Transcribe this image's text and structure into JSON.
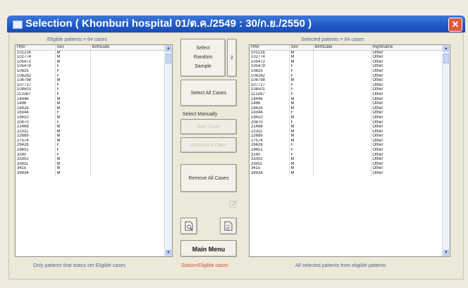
{
  "window": {
    "title": "Selection  ( Khonburi hospital  01/ต.ค./2549 : 30/ก.ย./2550 )",
    "close_glyph": "✕"
  },
  "left": {
    "caption": "Eligible patients = 64  cases",
    "columns": [
      "HN#",
      "Sex",
      "BirthDate"
    ],
    "rows": [
      [
        "101216",
        "M",
        ""
      ],
      [
        "102774",
        "M",
        ""
      ],
      [
        "105472",
        "M",
        ""
      ],
      [
        "105479",
        "F",
        ""
      ],
      [
        "10625",
        "F",
        ""
      ],
      [
        "106282",
        "F",
        ""
      ],
      [
        "106798",
        "M",
        ""
      ],
      [
        "107717",
        "F",
        ""
      ],
      [
        "108501",
        "F",
        ""
      ],
      [
        "113287",
        "F",
        ""
      ],
      [
        "14446",
        "M",
        ""
      ],
      [
        "1486",
        "M",
        ""
      ],
      [
        "18428",
        "M",
        ""
      ],
      [
        "18344",
        "F",
        ""
      ],
      [
        "19410",
        "M",
        ""
      ],
      [
        "20870",
        "F",
        ""
      ],
      [
        "21468",
        "M",
        ""
      ],
      [
        "22311",
        "M",
        ""
      ],
      [
        "22689",
        "M",
        ""
      ],
      [
        "27574",
        "M",
        ""
      ],
      [
        "29426",
        "F",
        ""
      ],
      [
        "29651",
        "F",
        ""
      ],
      [
        "3240",
        "F",
        ""
      ],
      [
        "33302",
        "M",
        ""
      ],
      [
        "33911",
        "M",
        ""
      ],
      [
        "3415",
        "M",
        ""
      ],
      [
        "39934",
        "M",
        ""
      ]
    ]
  },
  "right": {
    "caption": "Selected patients = 64  cases",
    "columns": [
      "HN#",
      "Sex",
      "BirthDate",
      "Rightname"
    ],
    "rows": [
      [
        "101216",
        "M",
        "",
        "Other"
      ],
      [
        "102774",
        "M",
        "",
        "Other"
      ],
      [
        "105472",
        "M",
        "",
        "Other"
      ],
      [
        "105479",
        "F",
        "",
        "Other"
      ],
      [
        "10625",
        "F",
        "",
        "Other"
      ],
      [
        "106282",
        "F",
        "",
        "Other"
      ],
      [
        "106798",
        "M",
        "",
        "Other"
      ],
      [
        "107717",
        "F",
        "",
        "Other"
      ],
      [
        "108501",
        "F",
        "",
        "Other"
      ],
      [
        "113287",
        "F",
        "",
        "Other"
      ],
      [
        "14446",
        "M",
        "",
        "Other"
      ],
      [
        "1486",
        "M",
        "",
        "Other"
      ],
      [
        "18428",
        "M",
        "",
        "Other"
      ],
      [
        "18344",
        "F",
        "",
        "Other"
      ],
      [
        "19410",
        "M",
        "",
        "Other"
      ],
      [
        "20870",
        "F",
        "",
        "Other"
      ],
      [
        "21468",
        "M",
        "",
        "Other"
      ],
      [
        "22311",
        "M",
        "",
        "Other"
      ],
      [
        "22689",
        "M",
        "",
        "Other"
      ],
      [
        "27574",
        "M",
        "",
        "Other"
      ],
      [
        "29426",
        "F",
        "",
        "Other"
      ],
      [
        "29651",
        "F",
        "",
        "Other"
      ],
      [
        "3240",
        "F",
        "",
        "Other"
      ],
      [
        "33302",
        "M",
        "",
        "Other"
      ],
      [
        "33911",
        "M",
        "",
        "Other"
      ],
      [
        "3415",
        "M",
        "",
        "Other"
      ],
      [
        "39934",
        "M",
        "",
        "Other"
      ]
    ]
  },
  "buttons": {
    "random_line1": "Select",
    "random_line2": "Random",
    "random_line3": "Sample",
    "random_spin": "2",
    "select_all": "Select All Cases",
    "select_manually": "Select Manually",
    "add_case": "Add Case",
    "remove_case": "Remove a Case",
    "remove_all": "Remove All Cases",
    "main_menu": "Main Menu"
  },
  "icons": {
    "edit": "edit-icon",
    "print_preview": "print-preview-icon",
    "report": "report-icon"
  },
  "status": {
    "left": "Only patients that status set Eligible cases",
    "center": "Status=Eligible cases",
    "right": "All selected patients from eligible patients"
  },
  "colors": {
    "title_bar": "#1f58c9",
    "close_button": "#e15a3a",
    "status_center": "#d9493c"
  }
}
